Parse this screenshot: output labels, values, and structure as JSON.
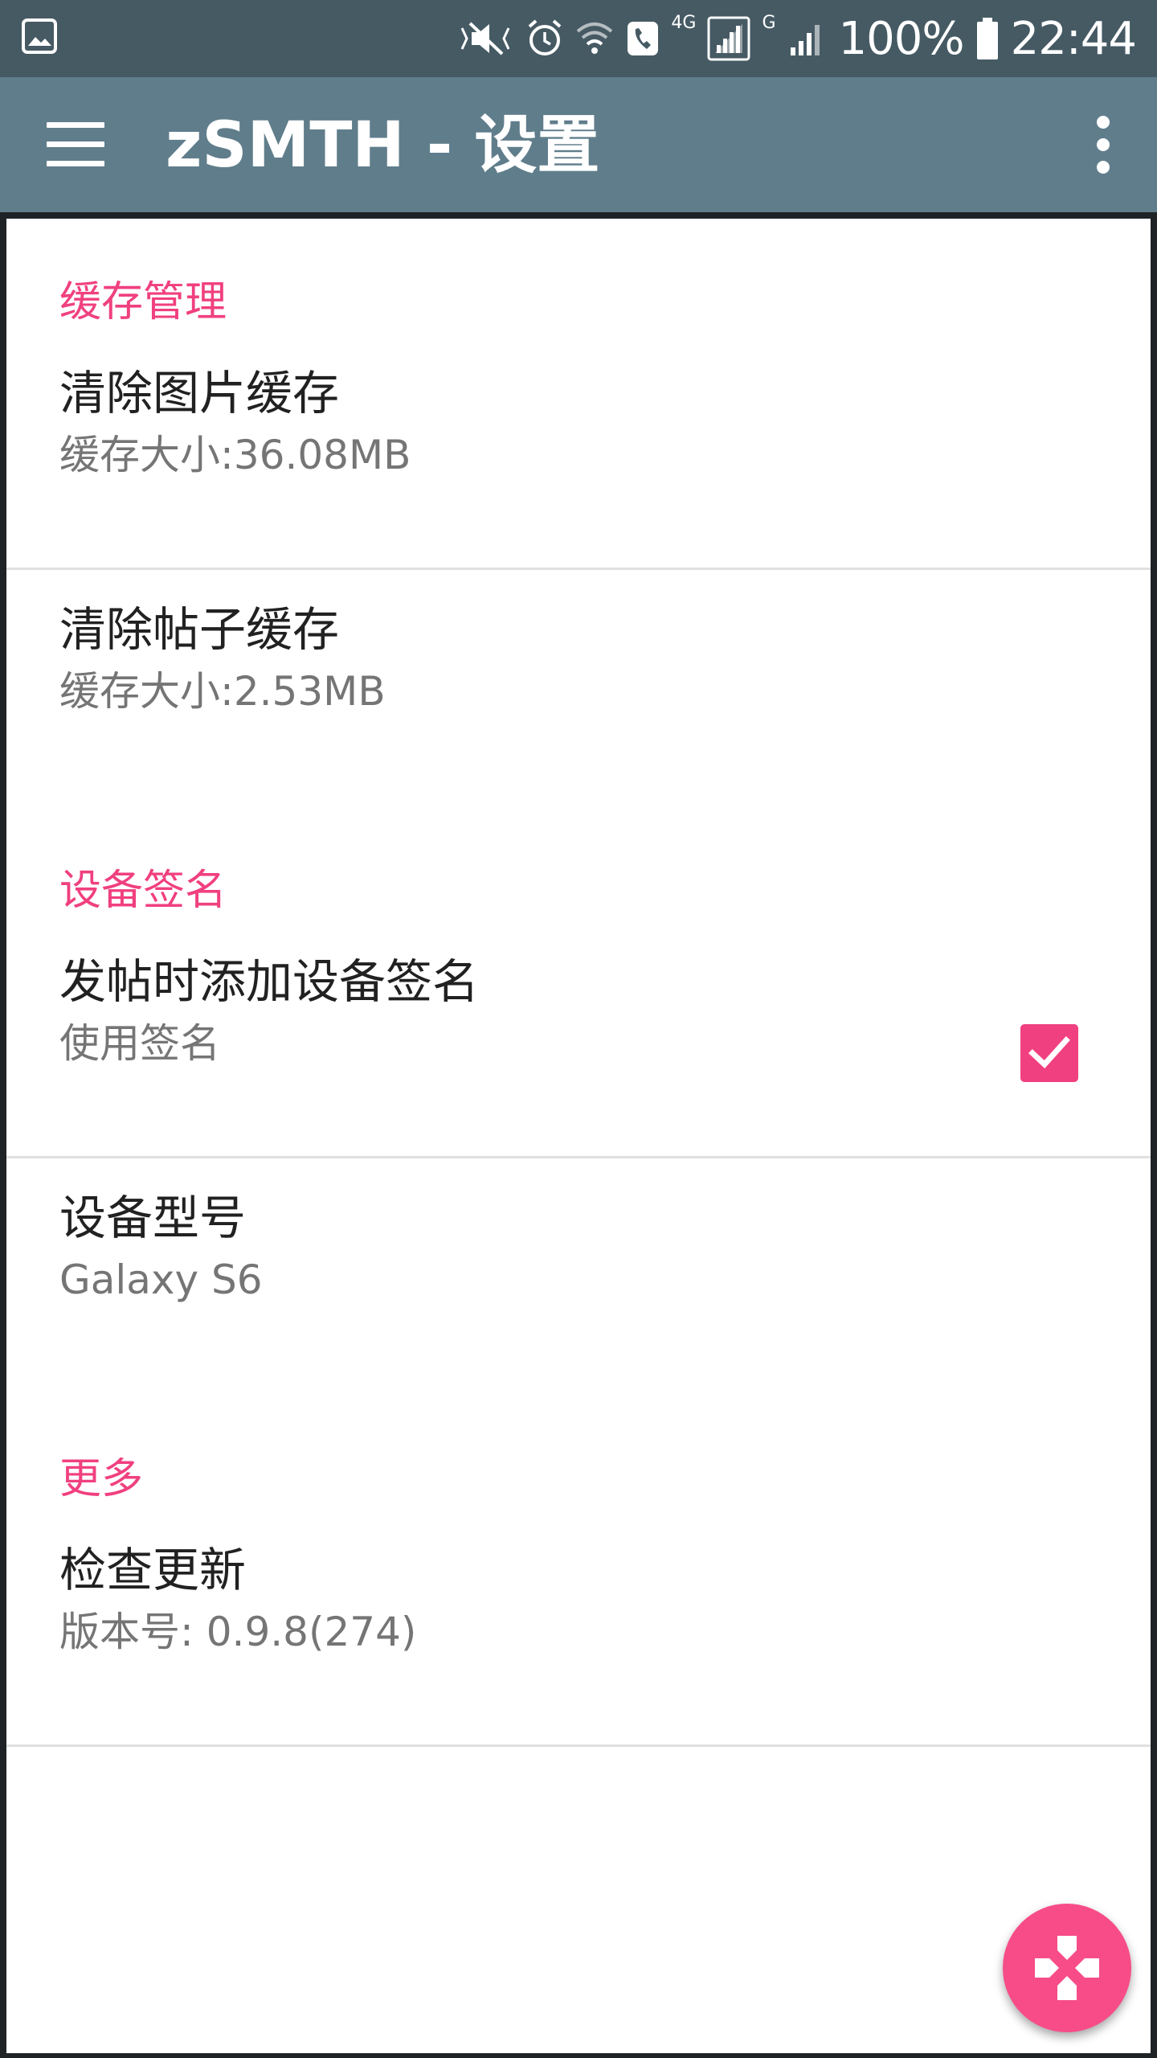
{
  "status_bar": {
    "battery": "100%",
    "network": "4G",
    "network2": "G",
    "time": "22:44",
    "icons": [
      "gallery-icon",
      "mute-vibrate-icon",
      "alarm-icon",
      "wifi-icon",
      "call-icon",
      "signal-4g-icon",
      "signal-g-icon",
      "battery-icon"
    ]
  },
  "app_bar": {
    "title": "zSMTH - 设置",
    "menu_icon": "hamburger-menu-icon",
    "overflow_icon": "more-vert-icon"
  },
  "sections": [
    {
      "header": "缓存管理",
      "items": [
        {
          "title": "清除图片缓存",
          "summary": "缓存大小:36.08MB"
        },
        {
          "title": "清除帖子缓存",
          "summary": "缓存大小:2.53MB"
        }
      ]
    },
    {
      "header": "设备签名",
      "items": [
        {
          "title": "发帖时添加设备签名",
          "summary": "使用签名",
          "checked": true
        },
        {
          "title": "设备型号",
          "summary": "Galaxy S6"
        }
      ]
    },
    {
      "header": "更多",
      "items": [
        {
          "title": "检查更新",
          "summary": "版本号: 0.9.8(274)"
        }
      ]
    }
  ],
  "fab": {
    "icon": "gamepad-icon"
  },
  "colors": {
    "status_bar": "#465a64",
    "app_bar": "#607d8b",
    "accent": "#f0407f",
    "fab": "#f74c88",
    "title_text": "#212121",
    "summary_text": "#757575"
  }
}
